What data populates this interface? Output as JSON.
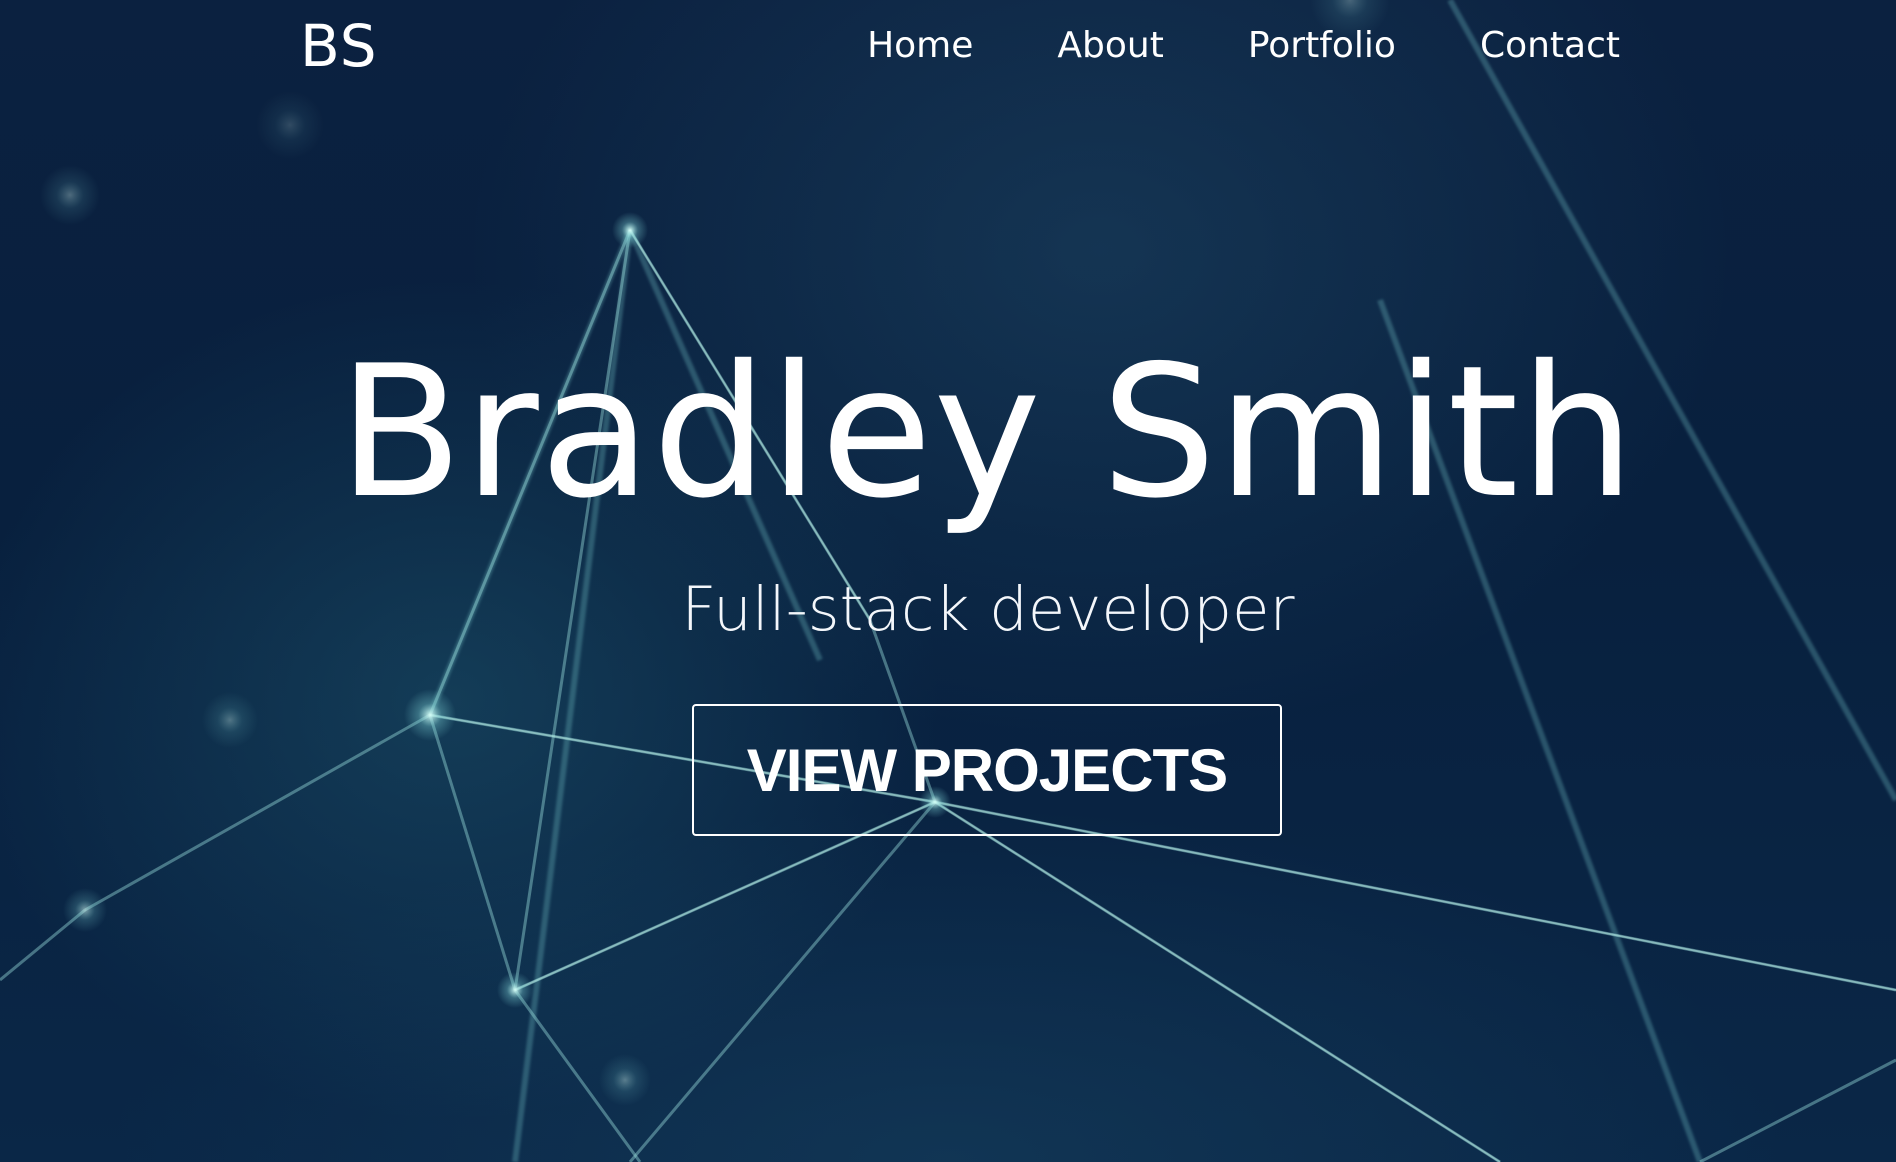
{
  "nav": {
    "logo": "BS",
    "links": [
      "Home",
      "About",
      "Portfolio",
      "Contact"
    ]
  },
  "hero": {
    "headline": "Bradley Smith",
    "subtitle": "Full-stack developer",
    "cta_label": "VIEW PROJECTS"
  },
  "colors": {
    "background": "#071a33",
    "text": "#ffffff",
    "network_lines": "#7fd3d6"
  }
}
